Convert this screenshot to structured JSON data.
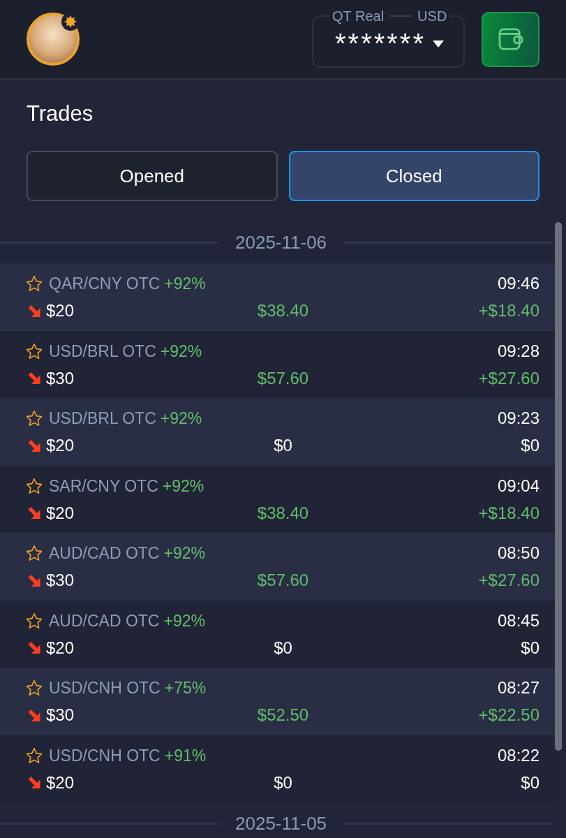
{
  "header": {
    "account": {
      "label": "QT Real",
      "currency": "USD",
      "balance": "*******"
    }
  },
  "title": "Trades",
  "tabs": [
    {
      "label": "Opened",
      "selected": false
    },
    {
      "label": "Closed",
      "selected": true
    }
  ],
  "groups": [
    {
      "date": "2025-11-06",
      "trades": [
        {
          "asset": "QAR/CNY OTC",
          "rate": "+92%",
          "time": "09:46",
          "up": false,
          "favorite": false,
          "amount": "$20",
          "payout": "$38.40",
          "profit": "+$18.40",
          "won": true
        },
        {
          "asset": "USD/BRL OTC",
          "rate": "+92%",
          "time": "09:28",
          "up": false,
          "favorite": false,
          "amount": "$30",
          "payout": "$57.60",
          "profit": "+$27.60",
          "won": true
        },
        {
          "asset": "USD/BRL OTC",
          "rate": "+92%",
          "time": "09:23",
          "up": false,
          "favorite": false,
          "amount": "$20",
          "payout": "$0",
          "profit": "$0",
          "won": false
        },
        {
          "asset": "SAR/CNY OTC",
          "rate": "+92%",
          "time": "09:04",
          "up": false,
          "favorite": false,
          "amount": "$20",
          "payout": "$38.40",
          "profit": "+$18.40",
          "won": true
        },
        {
          "asset": "AUD/CAD OTC",
          "rate": "+92%",
          "time": "08:50",
          "up": false,
          "favorite": false,
          "amount": "$30",
          "payout": "$57.60",
          "profit": "+$27.60",
          "won": true
        },
        {
          "asset": "AUD/CAD OTC",
          "rate": "+92%",
          "time": "08:45",
          "up": false,
          "favorite": false,
          "amount": "$20",
          "payout": "$0",
          "profit": "$0",
          "won": false
        },
        {
          "asset": "USD/CNH OTC",
          "rate": "+75%",
          "time": "08:27",
          "up": false,
          "favorite": false,
          "amount": "$30",
          "payout": "$52.50",
          "profit": "+$22.50",
          "won": true
        },
        {
          "asset": "USD/CNH OTC",
          "rate": "+91%",
          "time": "08:22",
          "up": false,
          "favorite": false,
          "amount": "$20",
          "payout": "$0",
          "profit": "$0",
          "won": false
        }
      ]
    },
    {
      "date": "2025-11-05"
    }
  ]
}
